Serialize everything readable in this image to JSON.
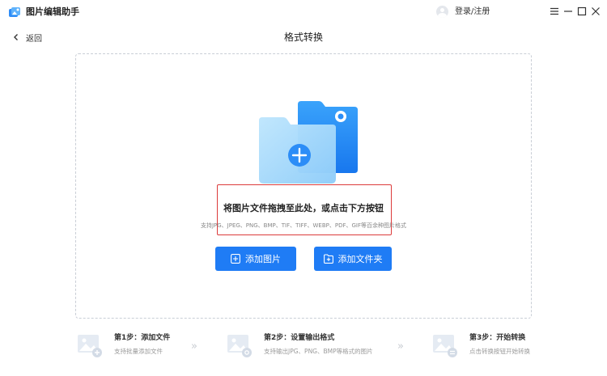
{
  "app": {
    "title": "图片编辑助手"
  },
  "header": {
    "login_label": "登录/注册"
  },
  "nav": {
    "back_label": "返回",
    "page_title": "格式转换"
  },
  "dropzone": {
    "instruction": "将图片文件拖拽至此处，或点击下方按钮",
    "supported": "支持JPG、JPEG、PNG、BMP、TIF、TIFF、WEBP、PDF、GIF等百余种图片格式"
  },
  "buttons": {
    "add_image": "添加图片",
    "add_folder": "添加文件夹"
  },
  "steps": [
    {
      "title": "第1步：添加文件",
      "desc": "支持批量添加文件",
      "icon": "image-add-icon"
    },
    {
      "title": "第2步：设置输出格式",
      "desc": "支持输出JPG、PNG、BMP等格式的图片",
      "icon": "image-settings-icon"
    },
    {
      "title": "第3步：开始转换",
      "desc": "点击转换按钮开始转换",
      "icon": "image-convert-icon"
    }
  ],
  "step_arrow": "»",
  "colors": {
    "accent": "#1f7cf5",
    "highlight_border": "#dc3b3b",
    "dashed_border": "#c9ced6"
  }
}
